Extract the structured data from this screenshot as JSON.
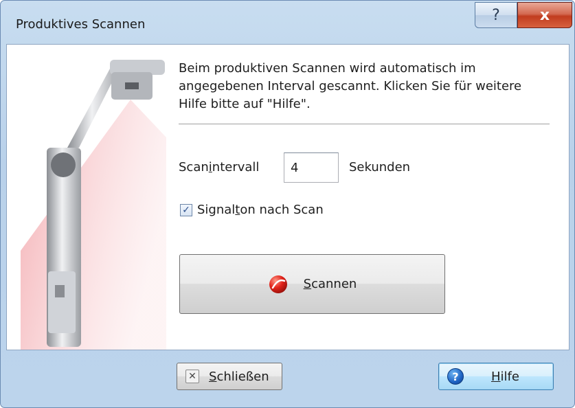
{
  "window": {
    "title": "Produktives Scannen",
    "help_glyph": "?",
    "close_glyph": "x"
  },
  "main": {
    "description": "Beim produktiven Scannen wird automatisch im angegebenen Interval gescannt. Klicken Sie für weitere Hilfe bitte auf \"Hilfe\".",
    "interval_label_pre": "Scan",
    "interval_label_accel": "i",
    "interval_label_post": "ntervall",
    "interval_value": "4",
    "seconds_label": "Sekunden",
    "signal_checked": true,
    "signal_label_pre": "Signal",
    "signal_label_accel": "t",
    "signal_label_post": "on nach Scan",
    "scan_label_accel": "S",
    "scan_label_post": "cannen"
  },
  "footer": {
    "close_accel": "S",
    "close_post": "chließen",
    "help_accel": "H",
    "help_post": "ilfe"
  },
  "icons": {
    "scanner_illustration": "document-scanner-illustration",
    "scan": "red-scan-icon",
    "close": "close-x-icon",
    "help": "help-question-icon"
  },
  "colors": {
    "title_bar": "#bcd4ec",
    "close_button": "#c13c1f",
    "help_button": "#bee6fd"
  }
}
